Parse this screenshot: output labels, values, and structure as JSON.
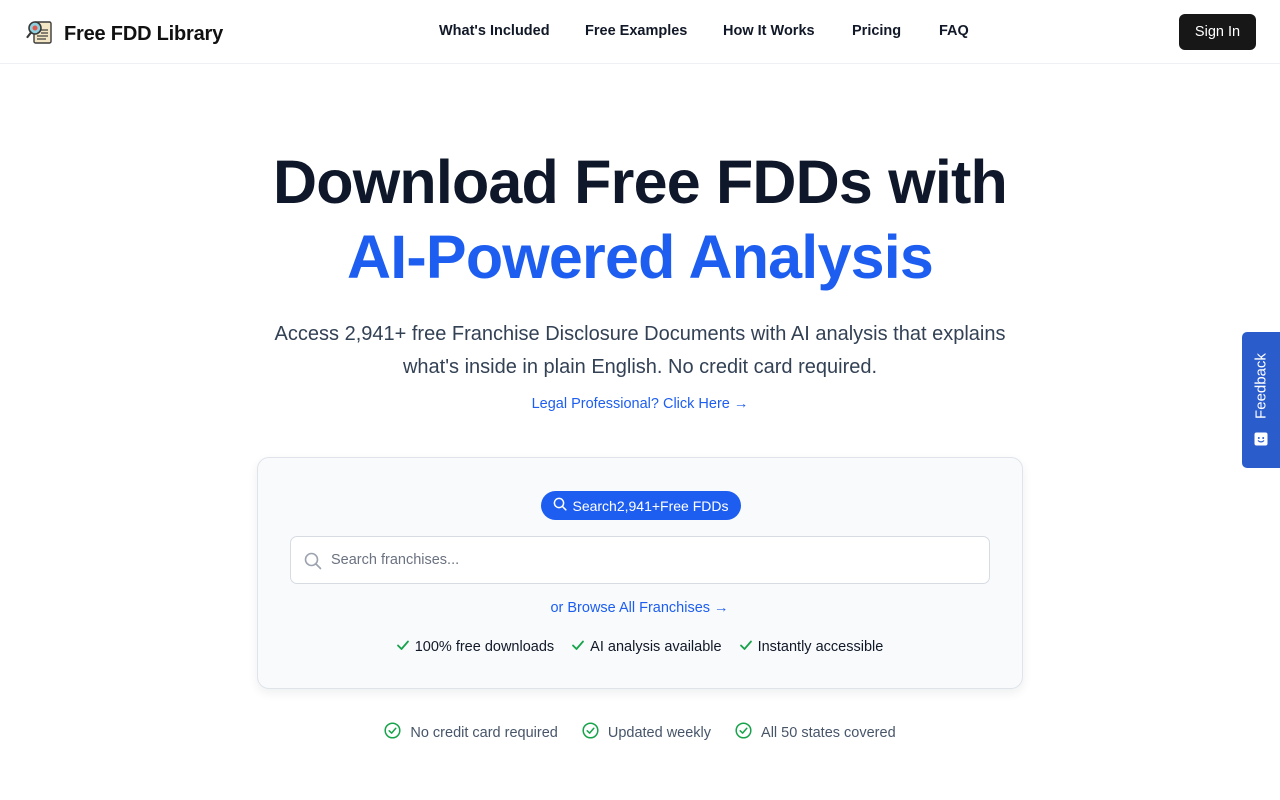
{
  "brand": {
    "name": "Free FDD Library",
    "logo_icon": "magnifier-document-icon"
  },
  "nav": {
    "items": [
      {
        "label": "What's Included"
      },
      {
        "label": "Free Examples"
      },
      {
        "label": "How It Works"
      },
      {
        "label": "Pricing"
      },
      {
        "label": "FAQ"
      }
    ],
    "signin_label": "Sign In"
  },
  "hero": {
    "title_line1": "Download Free FDDs with",
    "title_line2": "AI-Powered Analysis",
    "subtitle": "Access 2,941+ free Franchise Disclosure Documents with AI analysis that explains what's inside in plain English. No credit card required.",
    "legal_link": "Legal Professional? Click Here →"
  },
  "search_card": {
    "pill_label": "Search2,941+Free FDDs",
    "search_placeholder": "Search franchises...",
    "browse_link": "or Browse All Franchises →",
    "checks": [
      {
        "label": "100% free downloads"
      },
      {
        "label": "AI analysis available"
      },
      {
        "label": "Instantly accessible"
      }
    ]
  },
  "trust": [
    {
      "label": "No credit card required"
    },
    {
      "label": "Updated weekly"
    },
    {
      "label": "All 50 states covered"
    }
  ],
  "feedback": {
    "label": "Feedback"
  },
  "colors": {
    "accent": "#1d5ef0",
    "dark": "#0f172a",
    "check_green": "#16a34a",
    "feedback_bg": "#2b5ccc"
  }
}
